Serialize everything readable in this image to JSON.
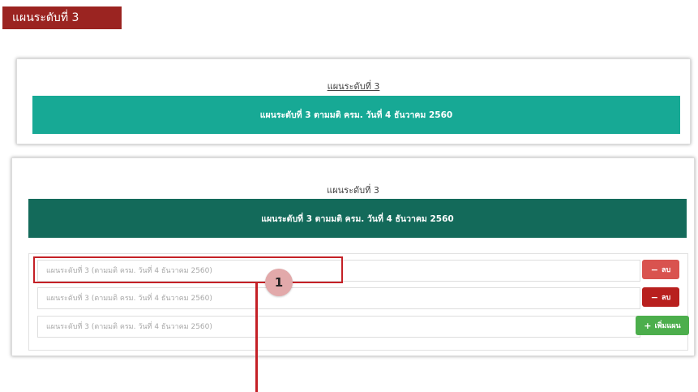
{
  "section_tag": "แผนระดับที่ 3",
  "panel_top": {
    "title": "แผนระดับที่ 3",
    "banner": "แผนระดับที่ 3 ตามมติ ครม. วันที่ 4 ธันวาคม 2560"
  },
  "panel_main": {
    "title": "แผนระดับที่ 3",
    "banner": "แผนระดับที่ 3 ตามมติ ครม. วันที่ 4 ธันวาคม 2560",
    "rows": [
      {
        "placeholder": "แผนระดับที่ 3 (ตามมติ ครม. วันที่ 4 ธันวาคม 2560)",
        "button": "ลบ",
        "icon": "minus-icon"
      },
      {
        "placeholder": "แผนระดับที่ 3 (ตามมติ ครม. วันที่ 4 ธันวาคม 2560)",
        "button": "ลบ",
        "icon": "minus-icon"
      },
      {
        "placeholder": "แผนระดับที่ 3 (ตามมติ ครม. วันที่ 4 ธันวาคม 2560)",
        "button": "เพิ่มแผน",
        "icon": "plus-icon"
      }
    ]
  },
  "annotation": {
    "label": "1"
  },
  "colors": {
    "section_tag": "#9b2421",
    "banner_teal": "#17a995",
    "banner_dark": "#136a5a",
    "delete": "#d9534f",
    "delete_active": "#b8201e",
    "add": "#4cae4c",
    "callout": "#c42026"
  }
}
